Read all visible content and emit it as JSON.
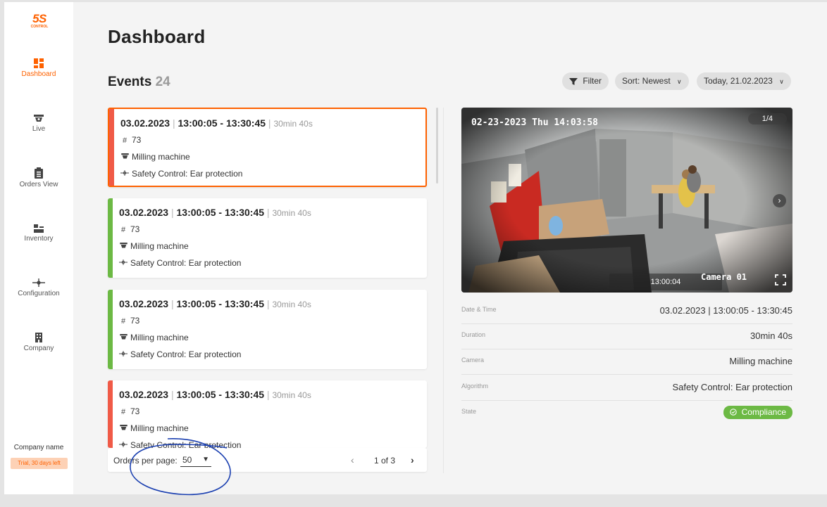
{
  "brand": {
    "logo_main": "5S",
    "logo_sub": "CONTROL",
    "accent": "#fe6100"
  },
  "sidebar": {
    "items": [
      {
        "label": "Dashboard",
        "icon": "dashboard-icon"
      },
      {
        "label": "Live",
        "icon": "camera-icon"
      },
      {
        "label": "Orders View",
        "icon": "clipboard-icon"
      },
      {
        "label": "Inventory",
        "icon": "inventory-icon"
      },
      {
        "label": "Configuration",
        "icon": "configuration-icon"
      },
      {
        "label": "Company",
        "icon": "building-icon"
      }
    ],
    "active": "Dashboard",
    "company_name": "Company name",
    "trial_label": "Trial, 30 days left"
  },
  "page": {
    "title": "Dashboard",
    "events_label": "Events",
    "events_count": "24"
  },
  "toolbar": {
    "filter_label": "Filter",
    "sort_label": "Sort: Newest",
    "date_label": "Today, 21.02.2023"
  },
  "events": [
    {
      "datetime": "03.02.2023",
      "time_range": "13:00:05 - 13:30:45",
      "duration": "30min 40s",
      "number": "73",
      "camera": "Milling machine",
      "algorithm": "Safety Control: Ear protection",
      "status_color": "#f05a47",
      "selected": true
    },
    {
      "datetime": "03.02.2023",
      "time_range": "13:00:05 - 13:30:45",
      "duration": "30min 40s",
      "number": "73",
      "camera": "Milling machine",
      "algorithm": "Safety Control: Ear protection",
      "status_color": "#6cb944",
      "selected": false
    },
    {
      "datetime": "03.02.2023",
      "time_range": "13:00:05 - 13:30:45",
      "duration": "30min 40s",
      "number": "73",
      "camera": "Milling machine",
      "algorithm": "Safety Control: Ear protection",
      "status_color": "#6cb944",
      "selected": false
    },
    {
      "datetime": "03.02.2023",
      "time_range": "13:00:05 - 13:30:45",
      "duration": "30min 40s",
      "number": "73",
      "camera": "Milling machine",
      "algorithm": "Safety Control: Ear protection",
      "status_color": "#f05a47",
      "selected": false
    }
  ],
  "pagination": {
    "per_page_label": "Orders per page:",
    "per_page_value": "50",
    "page_text": "1 of 3"
  },
  "camera": {
    "overlay_timestamp": "02-23-2023 Thu 14:03:58",
    "counter": "1/4",
    "playback_time": "13:00:04",
    "camera_label": "Camera 01"
  },
  "details": {
    "date_time_label": "Date & Time",
    "date_time_value": "03.02.2023 | 13:00:05 - 13:30:45",
    "duration_label": "Duration",
    "duration_value": "30min 40s",
    "camera_label": "Camera",
    "camera_value": "Milling machine",
    "algorithm_label": "Algorithm",
    "algorithm_value": "Safety Control: Ear protection",
    "state_label": "State",
    "state_value": "Compliance",
    "state_color": "#6cb944"
  }
}
